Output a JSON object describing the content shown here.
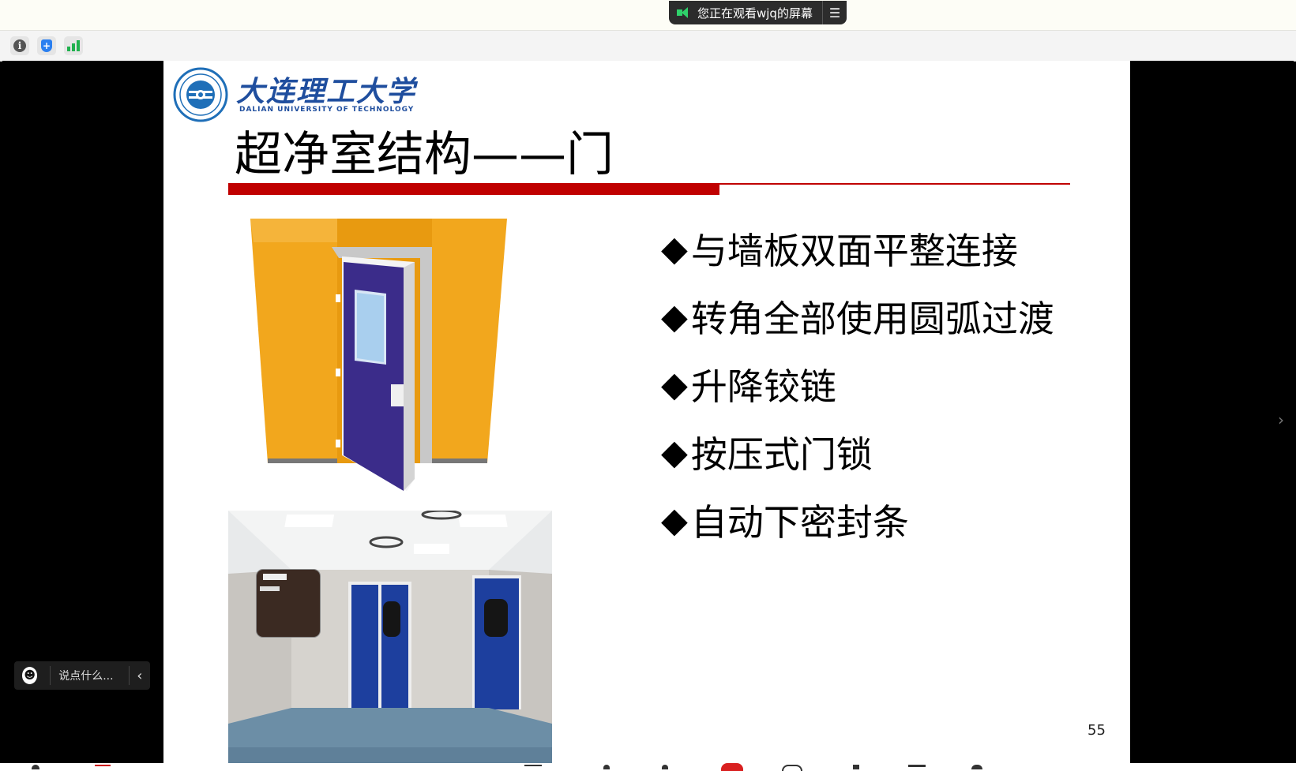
{
  "share_banner": {
    "text": "您正在观看wjq的屏幕",
    "menu_icon": "menu-lines-icon",
    "status_color": "#2fd16a"
  },
  "toolbar": {
    "icons": [
      "info-icon",
      "shield-icon",
      "signal-strength-icon"
    ],
    "info_glyph": "i",
    "shield_glyph": "+"
  },
  "slide": {
    "logo_cn": "大连理工大学",
    "logo_en": "DALIAN UNIVERSITY OF TECHNOLOGY",
    "title": "超净室结构——门",
    "accent_color": "#c00000",
    "bullet_symbol": "◆",
    "bullets": [
      "与墙板双面平整连接",
      "转角全部使用圆弧过渡",
      "升降铰链",
      "按压式门锁",
      "自动下密封条"
    ],
    "page_number": "55"
  },
  "chat": {
    "placeholder": "说点什么...",
    "collapse_glyph": "‹"
  },
  "nav": {
    "next_glyph": "›"
  }
}
